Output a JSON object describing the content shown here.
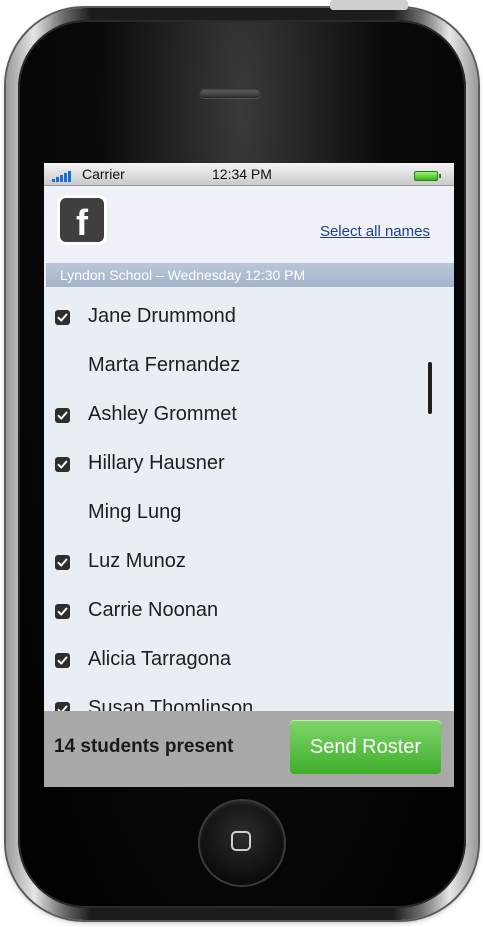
{
  "status_bar": {
    "carrier": "Carrier",
    "time": "12:34 PM",
    "signal_icon": "signal-bars-icon",
    "battery_icon": "battery-icon"
  },
  "header": {
    "app_icon": "facebook-icon",
    "app_icon_glyph": "f",
    "select_all_label": "Select all names",
    "subheader": "Lyndon School – Wednesday 12:30 PM"
  },
  "students": [
    {
      "name": "Jane Drummond",
      "checked": true
    },
    {
      "name": "Marta Fernandez",
      "checked": false
    },
    {
      "name": "Ashley Grommet",
      "checked": true
    },
    {
      "name": "Hillary Hausner",
      "checked": true
    },
    {
      "name": "Ming Lung",
      "checked": false
    },
    {
      "name": "Luz Munoz",
      "checked": true
    },
    {
      "name": "Carrie Noonan",
      "checked": true
    },
    {
      "name": "Alicia Tarragona",
      "checked": true
    },
    {
      "name": "Susan Thomlinson",
      "checked": true
    }
  ],
  "footer": {
    "present_label": "14 students present",
    "send_button_label": "Send Roster"
  },
  "colors": {
    "send_button": "#4cb935",
    "subheader_bg": "#aebdd3",
    "link": "#1f3f8a"
  }
}
